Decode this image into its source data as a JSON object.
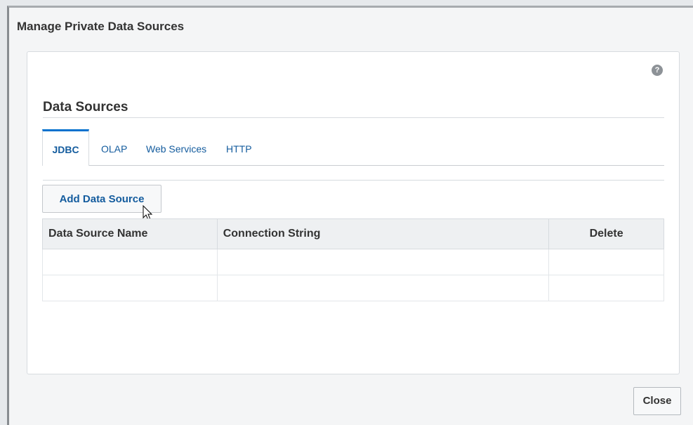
{
  "dialog": {
    "title": "Manage Private Data Sources",
    "help_icon": "help-icon",
    "close_label": "Close"
  },
  "section": {
    "title": "Data Sources"
  },
  "tabs": [
    {
      "label": "JDBC",
      "active": true
    },
    {
      "label": "OLAP",
      "active": false
    },
    {
      "label": "Web Services",
      "active": false
    },
    {
      "label": "HTTP",
      "active": false
    }
  ],
  "toolbar": {
    "add_label": "Add Data Source"
  },
  "table": {
    "headers": [
      "Data Source Name",
      "Connection String",
      "Delete"
    ],
    "rows": [
      [
        "",
        "",
        ""
      ],
      [
        "",
        "",
        ""
      ]
    ]
  },
  "colors": {
    "accent": "#0572ce",
    "link": "#145c9e",
    "header_bg": "#eef0f2"
  }
}
